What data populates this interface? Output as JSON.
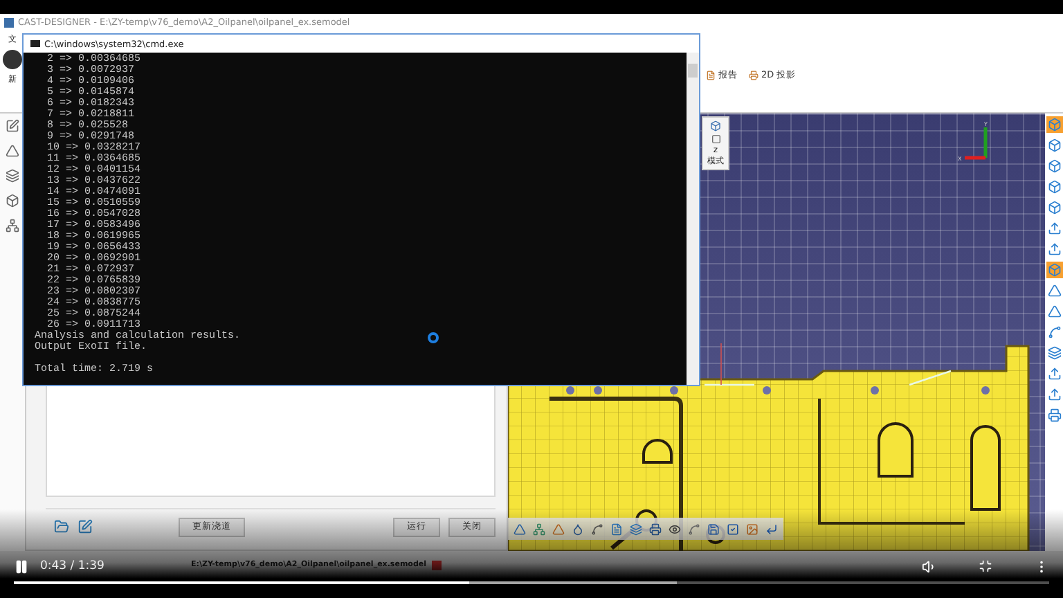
{
  "app_window": {
    "title": "CAST-DESIGNER - E:\\ZY-temp\\v76_demo\\A2_Oilpanel\\oilpanel_ex.semodel",
    "menu_fragment": "文",
    "logo_caption": "新"
  },
  "ribbon": [
    {
      "label": "报告"
    },
    {
      "label": "2D 投影"
    }
  ],
  "viewport": {
    "view_cube_label": "z",
    "mode_label": "模式",
    "axis_x": "X",
    "axis_y": "Y"
  },
  "right_tools": [
    {
      "selected": true
    },
    {
      "selected": false
    },
    {
      "selected": false
    },
    {
      "selected": false
    },
    {
      "selected": false
    },
    {
      "selected": false
    },
    {
      "selected": false
    },
    {
      "selected": true
    },
    {
      "selected": false
    },
    {
      "selected": false
    },
    {
      "selected": false
    },
    {
      "selected": false
    },
    {
      "selected": false
    },
    {
      "selected": false
    },
    {
      "selected": false
    }
  ],
  "dialog": {
    "buttons": [
      "更新浇道",
      "运行",
      "关闭"
    ]
  },
  "cmd_window": {
    "title": "C:\\windows\\system32\\cmd.exe",
    "lines": [
      "  2 => 0.00364685",
      "  3 => 0.0072937",
      "  4 => 0.0109406",
      "  5 => 0.0145874",
      "  6 => 0.0182343",
      "  7 => 0.0218811",
      "  8 => 0.025528",
      "  9 => 0.0291748",
      "  10 => 0.0328217",
      "  11 => 0.0364685",
      "  12 => 0.0401154",
      "  13 => 0.0437622",
      "  14 => 0.0474091",
      "  15 => 0.0510559",
      "  16 => 0.0547028",
      "  17 => 0.0583496",
      "  18 => 0.0619965",
      "  19 => 0.0656433",
      "  20 => 0.0692901",
      "  21 => 0.072937",
      "  22 => 0.0765839",
      "  23 => 0.0802307",
      "  24 => 0.0838775",
      "  25 => 0.0875244",
      "  26 => 0.0911713",
      "Analysis and calculation results.",
      "Output ExoII file."
    ],
    "total": "Total time: 2.719 s"
  },
  "status_bar": {
    "path": "E:\\ZY-temp\\v76_demo\\A2_Oilpanel\\oilpanel_ex.semodel"
  },
  "video_player": {
    "playing": true,
    "time": "0:43 / 1:39",
    "level": 0.44
  }
}
